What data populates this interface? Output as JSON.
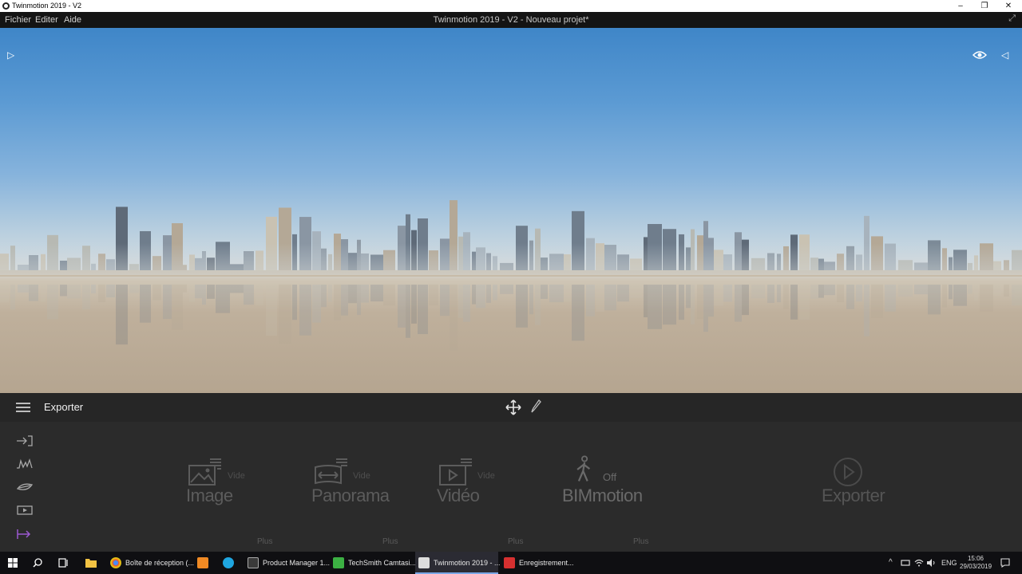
{
  "window": {
    "title": "Twinmotion 2019 - V2",
    "controls": {
      "minimize": "–",
      "restore": "❐",
      "close": "✕"
    }
  },
  "menubar": {
    "items": [
      "Fichier",
      "Editer",
      "Aide"
    ],
    "document_title": "Twinmotion 2019 - V2 - Nouveau projet*",
    "expand_glyph": "⤢"
  },
  "viewport": {
    "left_toggle_glyph": "▷",
    "right_toggle_glyph": "◁"
  },
  "panel": {
    "title": "Exporter",
    "tiles": [
      {
        "label": "Image",
        "state": "Vide",
        "plus": "Plus",
        "icon": "image-icon"
      },
      {
        "label": "Panorama",
        "state": "Vide",
        "plus": "Plus",
        "icon": "panorama-icon"
      },
      {
        "label": "Vidéo",
        "state": "Vide",
        "plus": "Plus",
        "icon": "video-icon"
      },
      {
        "label": "BIMmotion",
        "state": "Off",
        "plus": "Plus",
        "icon": "walking-person-icon"
      }
    ],
    "export_label": "Exporter",
    "side_icons": [
      "import-icon",
      "settings-wave-icon",
      "landscape-icon",
      "media-icon",
      "export-icon"
    ],
    "accent_color": "#9b59d0"
  },
  "taskbar": {
    "apps": [
      {
        "label": "Boîte de réception (...",
        "icon": "chrome-icon",
        "color": "#e04a3a"
      },
      {
        "label": "",
        "icon": "firefox-f-icon",
        "color": "#f08a24"
      },
      {
        "label": "",
        "icon": "camtasia-c-icon",
        "color": "#1fa6e0"
      },
      {
        "label": "Product Manager 1...",
        "icon": "archicad-icon",
        "color": "#cccccc"
      },
      {
        "label": "TechSmith Camtasi...",
        "icon": "camtasia-icon",
        "color": "#3cb043"
      },
      {
        "label": "Twinmotion 2019 - ...",
        "icon": "twinmotion-icon",
        "color": "#dddddd"
      },
      {
        "label": "Enregistrement...",
        "icon": "recorder-icon",
        "color": "#d63030"
      }
    ],
    "language": "ENG",
    "time": "15:06",
    "date": "29/03/2019"
  }
}
